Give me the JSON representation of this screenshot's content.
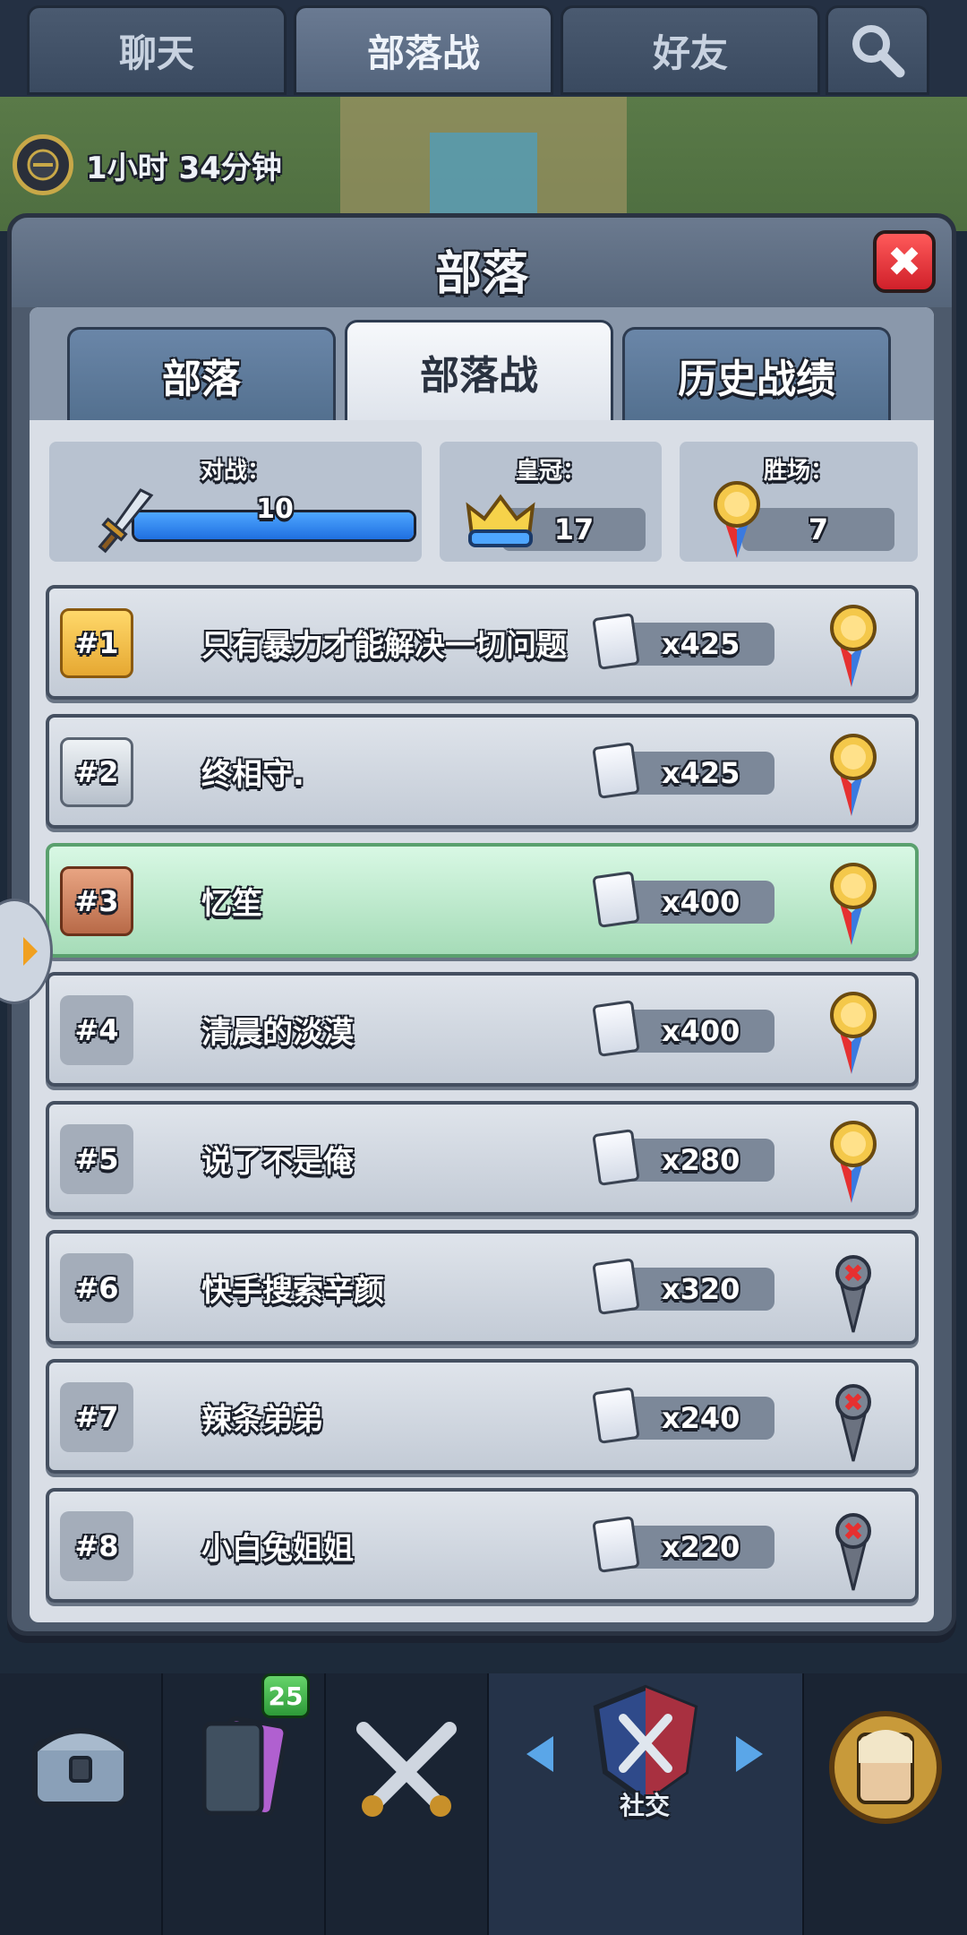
{
  "top_tabs": {
    "chat": "聊天",
    "clan_war": "部落战",
    "friends": "好友",
    "search_icon": "search-icon"
  },
  "scene": {
    "timer_text": "1小时 34分钟"
  },
  "modal": {
    "title": "部落",
    "close_label": "✖",
    "tabs": [
      "部落",
      "部落战",
      "历史战绩"
    ],
    "active_tab_index": 1,
    "stats": {
      "battles_label": "对战：",
      "battles_value": "10",
      "battles_fraction": 1.0,
      "crowns_label": "皇冠：",
      "crowns_value": "17",
      "wins_label": "胜场：",
      "wins_value": "7"
    },
    "rows": [
      {
        "rank": "#1",
        "name": "只有暴力才能解决一切问题",
        "cards": "x425",
        "result": "win",
        "tier": "gold"
      },
      {
        "rank": "#2",
        "name": "终相守.",
        "cards": "x425",
        "result": "win",
        "tier": "silver"
      },
      {
        "rank": "#3",
        "name": "忆笙",
        "cards": "x400",
        "result": "win",
        "tier": "bronze"
      },
      {
        "rank": "#4",
        "name": "清晨的淡漠",
        "cards": "x400",
        "result": "win",
        "tier": "plain"
      },
      {
        "rank": "#5",
        "name": "说了不是俺",
        "cards": "x280",
        "result": "win",
        "tier": "plain"
      },
      {
        "rank": "#6",
        "name": "快手搜索辛颜",
        "cards": "x320",
        "result": "loss",
        "tier": "plain"
      },
      {
        "rank": "#7",
        "name": "辣条弟弟",
        "cards": "x240",
        "result": "loss",
        "tier": "plain"
      },
      {
        "rank": "#8",
        "name": "小白兔姐姐",
        "cards": "x220",
        "result": "loss",
        "tier": "plain"
      }
    ]
  },
  "bottom_nav": {
    "cards_badge": "25",
    "social_label": "社交"
  },
  "colors": {
    "win_medal": "#f4c84a",
    "loss_medal": "#6b7280",
    "highlight_row": "#a6dcb8",
    "accent_blue": "#1f6fe0"
  }
}
